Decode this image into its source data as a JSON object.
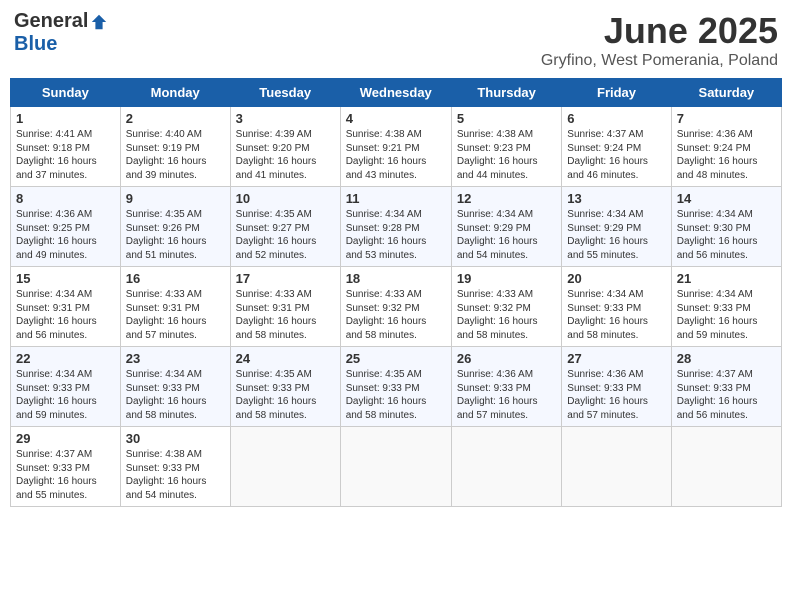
{
  "logo": {
    "general": "General",
    "blue": "Blue"
  },
  "title": "June 2025",
  "subtitle": "Gryfino, West Pomerania, Poland",
  "days_header": [
    "Sunday",
    "Monday",
    "Tuesday",
    "Wednesday",
    "Thursday",
    "Friday",
    "Saturday"
  ],
  "weeks": [
    [
      {
        "day": "1",
        "info": "Sunrise: 4:41 AM\nSunset: 9:18 PM\nDaylight: 16 hours\nand 37 minutes."
      },
      {
        "day": "2",
        "info": "Sunrise: 4:40 AM\nSunset: 9:19 PM\nDaylight: 16 hours\nand 39 minutes."
      },
      {
        "day": "3",
        "info": "Sunrise: 4:39 AM\nSunset: 9:20 PM\nDaylight: 16 hours\nand 41 minutes."
      },
      {
        "day": "4",
        "info": "Sunrise: 4:38 AM\nSunset: 9:21 PM\nDaylight: 16 hours\nand 43 minutes."
      },
      {
        "day": "5",
        "info": "Sunrise: 4:38 AM\nSunset: 9:23 PM\nDaylight: 16 hours\nand 44 minutes."
      },
      {
        "day": "6",
        "info": "Sunrise: 4:37 AM\nSunset: 9:24 PM\nDaylight: 16 hours\nand 46 minutes."
      },
      {
        "day": "7",
        "info": "Sunrise: 4:36 AM\nSunset: 9:24 PM\nDaylight: 16 hours\nand 48 minutes."
      }
    ],
    [
      {
        "day": "8",
        "info": "Sunrise: 4:36 AM\nSunset: 9:25 PM\nDaylight: 16 hours\nand 49 minutes."
      },
      {
        "day": "9",
        "info": "Sunrise: 4:35 AM\nSunset: 9:26 PM\nDaylight: 16 hours\nand 51 minutes."
      },
      {
        "day": "10",
        "info": "Sunrise: 4:35 AM\nSunset: 9:27 PM\nDaylight: 16 hours\nand 52 minutes."
      },
      {
        "day": "11",
        "info": "Sunrise: 4:34 AM\nSunset: 9:28 PM\nDaylight: 16 hours\nand 53 minutes."
      },
      {
        "day": "12",
        "info": "Sunrise: 4:34 AM\nSunset: 9:29 PM\nDaylight: 16 hours\nand 54 minutes."
      },
      {
        "day": "13",
        "info": "Sunrise: 4:34 AM\nSunset: 9:29 PM\nDaylight: 16 hours\nand 55 minutes."
      },
      {
        "day": "14",
        "info": "Sunrise: 4:34 AM\nSunset: 9:30 PM\nDaylight: 16 hours\nand 56 minutes."
      }
    ],
    [
      {
        "day": "15",
        "info": "Sunrise: 4:34 AM\nSunset: 9:31 PM\nDaylight: 16 hours\nand 56 minutes."
      },
      {
        "day": "16",
        "info": "Sunrise: 4:33 AM\nSunset: 9:31 PM\nDaylight: 16 hours\nand 57 minutes."
      },
      {
        "day": "17",
        "info": "Sunrise: 4:33 AM\nSunset: 9:31 PM\nDaylight: 16 hours\nand 58 minutes."
      },
      {
        "day": "18",
        "info": "Sunrise: 4:33 AM\nSunset: 9:32 PM\nDaylight: 16 hours\nand 58 minutes."
      },
      {
        "day": "19",
        "info": "Sunrise: 4:33 AM\nSunset: 9:32 PM\nDaylight: 16 hours\nand 58 minutes."
      },
      {
        "day": "20",
        "info": "Sunrise: 4:34 AM\nSunset: 9:33 PM\nDaylight: 16 hours\nand 58 minutes."
      },
      {
        "day": "21",
        "info": "Sunrise: 4:34 AM\nSunset: 9:33 PM\nDaylight: 16 hours\nand 59 minutes."
      }
    ],
    [
      {
        "day": "22",
        "info": "Sunrise: 4:34 AM\nSunset: 9:33 PM\nDaylight: 16 hours\nand 59 minutes."
      },
      {
        "day": "23",
        "info": "Sunrise: 4:34 AM\nSunset: 9:33 PM\nDaylight: 16 hours\nand 58 minutes."
      },
      {
        "day": "24",
        "info": "Sunrise: 4:35 AM\nSunset: 9:33 PM\nDaylight: 16 hours\nand 58 minutes."
      },
      {
        "day": "25",
        "info": "Sunrise: 4:35 AM\nSunset: 9:33 PM\nDaylight: 16 hours\nand 58 minutes."
      },
      {
        "day": "26",
        "info": "Sunrise: 4:36 AM\nSunset: 9:33 PM\nDaylight: 16 hours\nand 57 minutes."
      },
      {
        "day": "27",
        "info": "Sunrise: 4:36 AM\nSunset: 9:33 PM\nDaylight: 16 hours\nand 57 minutes."
      },
      {
        "day": "28",
        "info": "Sunrise: 4:37 AM\nSunset: 9:33 PM\nDaylight: 16 hours\nand 56 minutes."
      }
    ],
    [
      {
        "day": "29",
        "info": "Sunrise: 4:37 AM\nSunset: 9:33 PM\nDaylight: 16 hours\nand 55 minutes."
      },
      {
        "day": "30",
        "info": "Sunrise: 4:38 AM\nSunset: 9:33 PM\nDaylight: 16 hours\nand 54 minutes."
      },
      {
        "day": "",
        "info": ""
      },
      {
        "day": "",
        "info": ""
      },
      {
        "day": "",
        "info": ""
      },
      {
        "day": "",
        "info": ""
      },
      {
        "day": "",
        "info": ""
      }
    ]
  ]
}
